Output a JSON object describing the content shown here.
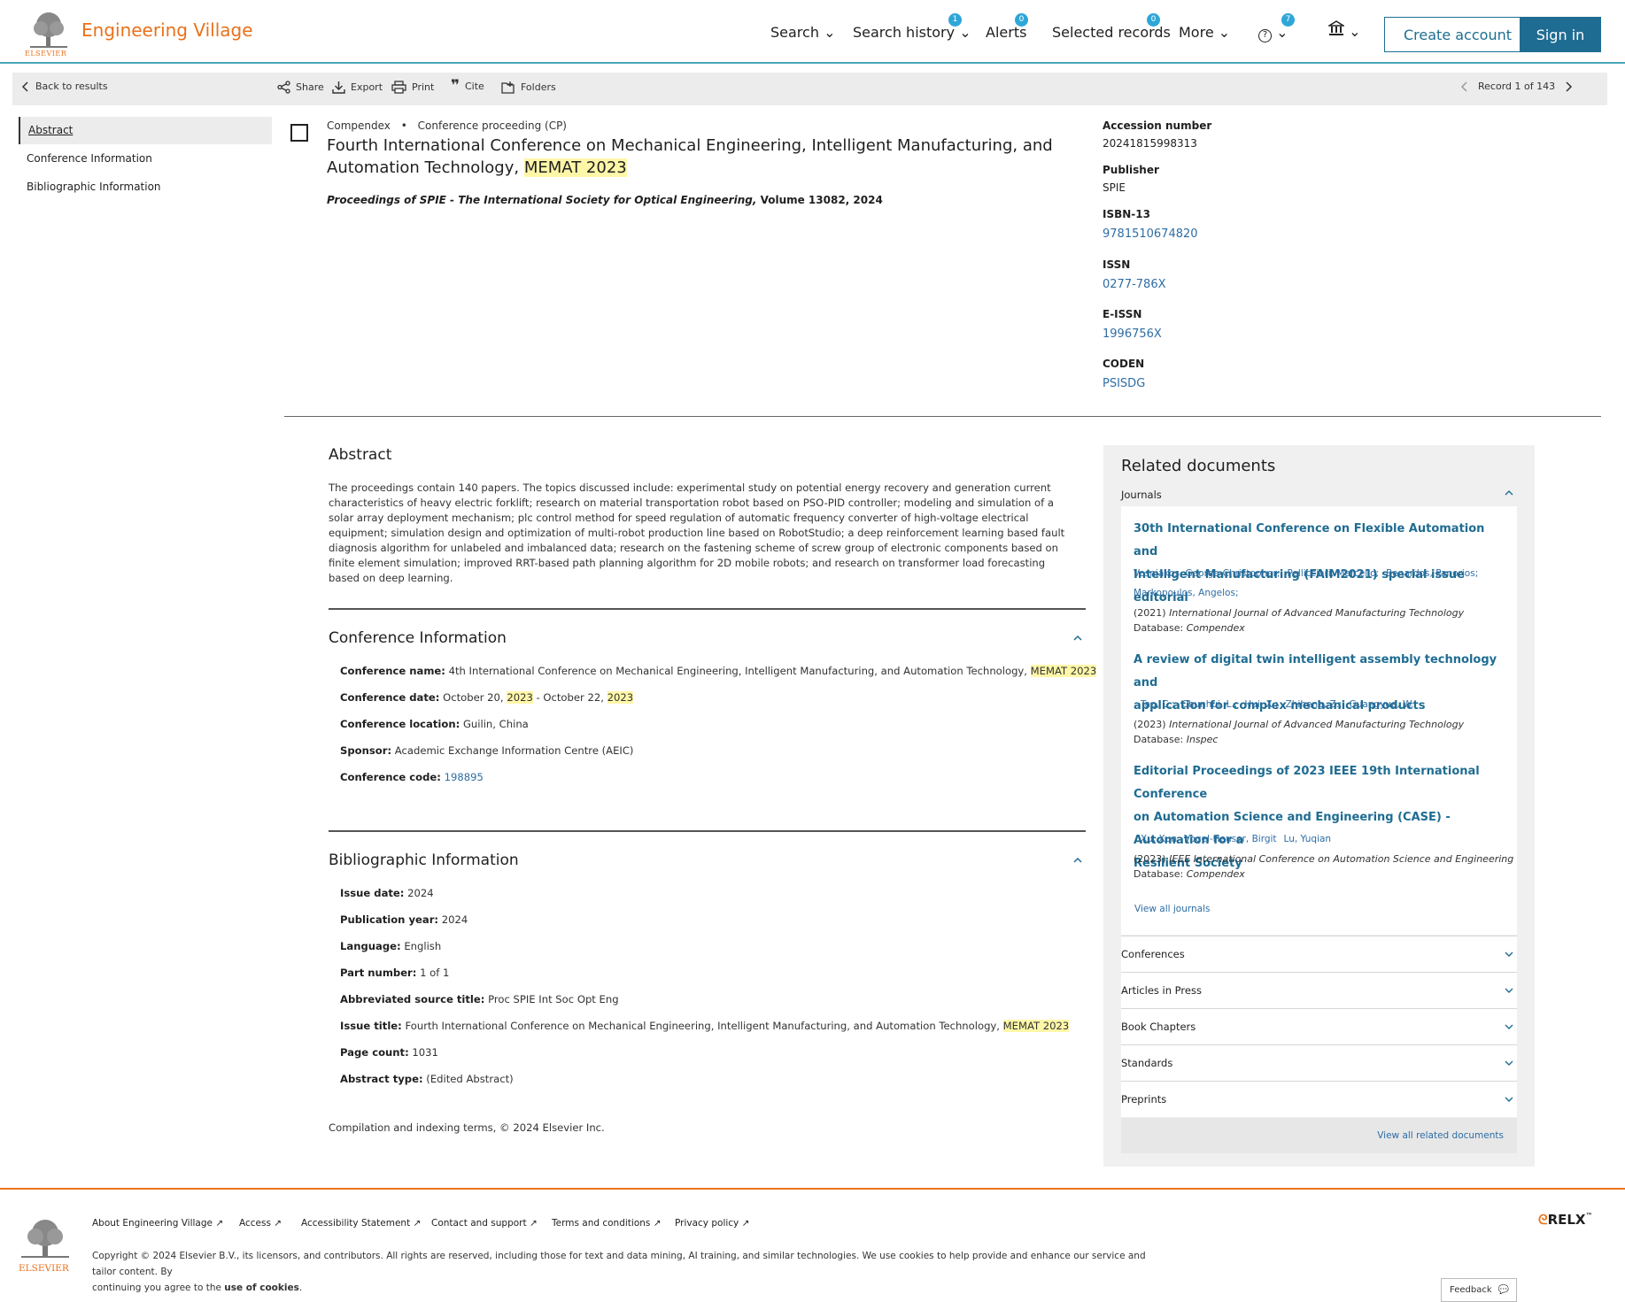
{
  "header": {
    "brand": "Engineering Village",
    "publisher_logo_text": "ELSEVIER",
    "nav": {
      "search": "Search",
      "search_history": "Search history",
      "search_history_badge": "1",
      "alerts": "Alerts",
      "alerts_badge": "0",
      "selected_records": "Selected records",
      "selected_records_badge": "0",
      "more": "More",
      "help_badge": "7"
    },
    "create_account": "Create account",
    "sign_in": "Sign in"
  },
  "toolbar": {
    "back": "Back to results",
    "share": "Share",
    "export": "Export",
    "print": "Print",
    "cite": "Cite",
    "folders": "Folders",
    "record": "Record 1 of 143"
  },
  "left_nav": [
    "Abstract",
    "Conference Information",
    "Bibliographic Information"
  ],
  "document": {
    "database": "Compendex",
    "doc_type": "Conference proceeding (CP)",
    "title_main": "Fourth International Conference on Mechanical Engineering, Intelligent Manufacturing, and Automation Technology, ",
    "title_highlight": "MEMAT 2023",
    "source_italic": "Proceedings of SPIE - The International Society for Optical Engineering,",
    "source_rest": " Volume 13082, 2024"
  },
  "record_keys": {
    "accession_label": "Accession number",
    "accession_value": "20241815998313",
    "publisher_label": "Publisher",
    "publisher_value": "SPIE",
    "isbn_label": "ISBN-13",
    "isbn_value": "9781510674820",
    "issn_label": "ISSN",
    "issn_value": "0277-786X",
    "eissn_label": "E-ISSN",
    "eissn_value": "1996756X",
    "coden_label": "CODEN",
    "coden_value": "PSISDG"
  },
  "abstract": {
    "heading": "Abstract",
    "text": "The proceedings contain 140 papers. The topics discussed include: experimental study on potential energy recovery and generation current characteristics of heavy electric forklift; research on material transportation robot based on PSO-PID controller; modeling and simulation of a solar array deployment mechanism; plc control method for speed regulation of automatic frequency converter of high-voltage electrical equipment; simulation design and optimization of multi-robot production line based on RobotStudio; a deep reinforcement learning based fault diagnosis algorithm for unlabeled and imbalanced data; research on the fastening scheme of screw group of electronic components based on finite element simulation; improved RRT-based path planning algorithm for 2D mobile robots; and research on transformer load forecasting based on deep learning."
  },
  "conference": {
    "heading": "Conference Information",
    "name_label": "Conference name:",
    "name_value": "4th International Conference on Mechanical Engineering, Intelligent Manufacturing, and Automation Technology,",
    "name_highlight": "MEMAT 2023",
    "date_label": "Conference date:",
    "date_a": "October 20,",
    "date_year1": "2023",
    "date_b": " - October 22,",
    "date_year2": "2023",
    "location_label": "Conference location:",
    "location_value": "Guilin, China",
    "sponsor_label": "Sponsor:",
    "sponsor_value": "Academic Exchange Information Centre (AEIC)",
    "code_label": "Conference code:",
    "code_value": "198895"
  },
  "bibliographic": {
    "heading": "Bibliographic Information",
    "issue_date_label": "Issue date:",
    "issue_date_value": "2024",
    "pub_year_label": "Publication year:",
    "pub_year_value": "2024",
    "language_label": "Language:",
    "language_value": "English",
    "part_label": "Part number:",
    "part_value": "1 of 1",
    "abbrev_label": "Abbreviated source title:",
    "abbrev_value": "Proc SPIE Int Soc Opt Eng",
    "issue_title_label": "Issue title:",
    "issue_title_value": "Fourth International Conference on Mechanical Engineering, Intelligent Manufacturing, and Automation Technology,",
    "issue_title_highlight": "MEMAT 2023",
    "page_count_label": "Page count:",
    "page_count_value": "1031",
    "abstract_type_label": "Abstract type:",
    "abstract_type_value": "(Edited Abstract)"
  },
  "compilation": "Compilation and indexing terms, © 2024 Elsevier Inc.",
  "related": {
    "title": "Related documents",
    "journals_label": "Journals",
    "items": [
      {
        "title_l1": "30th International Conference on Flexible Automation and",
        "title_l2": "Intelligent Manufacturing (FAIM2021) special issue editorial",
        "authors_l1": [
          "Vosniakos, George-Christopher;",
          "Pellicciari, Marcello;",
          "Benardos, Panorios;"
        ],
        "authors_l2": [
          "Markopoulos, Angelos;"
        ],
        "year": "(2021)",
        "journal": "International Journal of Advanced Manufacturing Technology",
        "db_label": "Database:",
        "db": "Compendex"
      },
      {
        "title_l1": "A review of digital twin intelligent assembly technology and",
        "title_l2": "application for complex mechanical products",
        "authors_l1": [
          "Tao, C.;",
          "Chunhui, L.;",
          "Hui, X.;",
          "Zhiheng, Z.;",
          "Guangyue, W.;"
        ],
        "year": "(2023)",
        "journal": "International Journal of Advanced Manufacturing Technology",
        "db_label": "Database:",
        "db": "Inspec"
      },
      {
        "title_l1": "Editorial Proceedings of 2023 IEEE 19th International Conference",
        "title_l2": "on Automation Science and Engineering (CASE) - Automation for a",
        "title_l3": "Resilient Society",
        "authors_l1": [
          "Xu, Xun",
          "Vogel-Heuser, Birgit",
          "Lu, Yuqian"
        ],
        "year": "(2023)",
        "journal": "IEEE International Conference on Automation Science and Engineering",
        "db_label": "Database:",
        "db": "Compendex"
      }
    ],
    "view_all_journals": "View all journals",
    "conferences": "Conferences",
    "articles_in_press": "Articles in Press",
    "book_chapters": "Book Chapters",
    "standards": "Standards",
    "preprints": "Preprints",
    "view_all_related": "View all related documents"
  },
  "footer": {
    "logo_text": "ELSEVIER",
    "links": [
      "About Engineering Village",
      "Access",
      "Accessibility Statement",
      "Contact and support",
      "Terms and conditions",
      "Privacy policy"
    ],
    "copyright_1": "Copyright © 2024 Elsevier B.V., its licensors, and contributors. All rights are reserved, including those for text and data mining, AI training, and similar technologies. We use cookies to help provide and enhance our service and tailor content. By",
    "copyright_2": "continuing you agree to the ",
    "cookies_link": "use of cookies",
    "relx": "RELX",
    "feedback": "Feedback"
  },
  "colors": {
    "brand_orange": "#e9711c",
    "accent_teal": "#4aa5b8",
    "primary_blue": "#1f6c92",
    "link_blue": "#2e6da4",
    "highlight": "#fff7a8"
  }
}
